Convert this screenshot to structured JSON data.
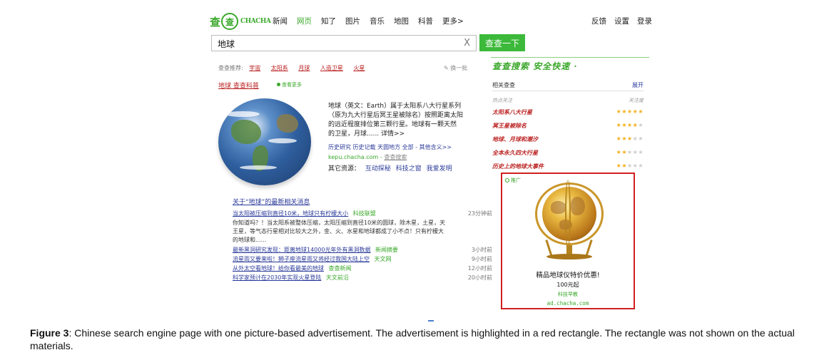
{
  "header": {
    "logo_ch": "查",
    "logo_circle": "查",
    "logo_en": "CHACHA",
    "nav": [
      {
        "label": "新闻",
        "active": false
      },
      {
        "label": "网页",
        "active": true
      },
      {
        "label": "知了",
        "active": false
      },
      {
        "label": "图片",
        "active": false
      },
      {
        "label": "音乐",
        "active": false
      },
      {
        "label": "地图",
        "active": false
      },
      {
        "label": "科普",
        "active": false
      },
      {
        "label": "更多>",
        "active": false
      }
    ],
    "top_links": [
      "反馈",
      "设置",
      "登录"
    ]
  },
  "search": {
    "query": "地球",
    "clear": "X",
    "button": "查查一下"
  },
  "suggestions": {
    "label": "查查推荐:",
    "items": [
      "宇宙",
      "太阳系",
      "月球",
      "人造卫星",
      "火星"
    ],
    "refresh": "换一批"
  },
  "main_result": {
    "title": "地球 查查科普",
    "badge": "查看更多",
    "description": [
      "地球（英文：Earth）属于太阳系八大行星系列",
      "（原为九大行星后冥王星被除名）按照距离太阳",
      "的远近程度排位第三颗行星。地球有一颗天然",
      "的卫星，月球...... 详情>>"
    ],
    "links": "历史研究 历史记载 天圆地方 全部 - 其他含义>>",
    "site": "kepu.chacha.com",
    "cache": "查查搜索",
    "other_label": "其它资源：",
    "other_links": [
      "互动探秘",
      "科技之窗",
      "我爱发明"
    ]
  },
  "news": {
    "heading": "关于“地球”的最新相关消息",
    "items": [
      {
        "title": "当太阳被压缩到直径10米，地球只有柠檬大小",
        "source": "科技联盟",
        "time": "23分钟前",
        "snippet": [
          "你知道吗？！当太阳系被整体压缩，太阳压缩到直径10米的圆球，除木星，土星，天",
          "王星，等气态行星相对比较大之外，金、火、水星和地球都成了小不点！只有柠檬大",
          "的地球和......"
        ]
      },
      {
        "title": "最新黑洞研究发现：距离地球14000光年外有黑洞数据",
        "source": "新闻摘要",
        "time": "3小时前",
        "snippet": []
      },
      {
        "title": "流星雨又要来啦！狮子座流星雨又将经过我国大陆上空",
        "source": "天文网",
        "time": "9小时前",
        "snippet": []
      },
      {
        "title": "从外太空看地球！给你看最美的地球",
        "source": "查查新闻",
        "time": "12小时前",
        "snippet": []
      },
      {
        "title": "科学家预计在2030年实现火星登陆",
        "source": "天文前沿",
        "time": "20小时前",
        "snippet": []
      }
    ]
  },
  "sidebar": {
    "slogan": "查查搜索  安全快速",
    "related_title": "相关查查",
    "expand": "展开",
    "col_topic": "热点关注",
    "col_attention": "关注度",
    "related": [
      {
        "label": "太阳系八大行星",
        "stars": 5
      },
      {
        "label": "冥王星被除名",
        "stars": 4
      },
      {
        "label": "地球、月球和潮汐",
        "stars": 3
      },
      {
        "label": "全本永久四大行星",
        "stars": 2
      },
      {
        "label": "历史上的地球大事件",
        "stars": 2
      }
    ],
    "star_total": 5
  },
  "ad": {
    "tag": "推广",
    "title": "精品地球仪特价优惠!",
    "price": "100元起",
    "source": "科技早教",
    "url": "ad.chacha.com"
  },
  "caption": {
    "label": "Figure 3",
    "text": ": Chinese search engine page with one picture-based advertisement. The advertisement is highlighted in a red rectangle. The rectangle was not shown on the actual materials."
  }
}
